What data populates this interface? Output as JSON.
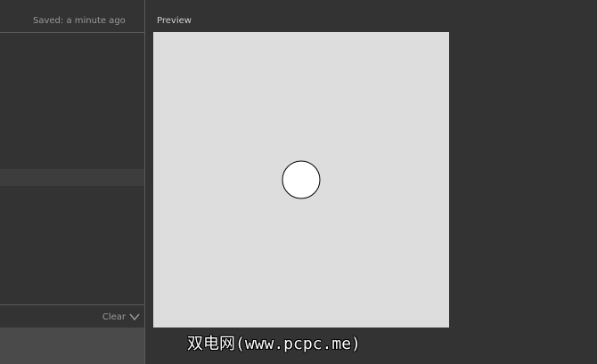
{
  "editor": {
    "saved_status": "Saved: a minute ago"
  },
  "console": {
    "clear_label": "Clear",
    "toggle_icon": "chevron-down-icon"
  },
  "preview": {
    "label": "Preview",
    "background": "#dddddd",
    "shape": {
      "type": "circle",
      "fill": "#ffffff",
      "stroke": "#000000"
    }
  },
  "watermark": {
    "text": "双电网(www.pcpc.me)"
  },
  "colors": {
    "app_background": "#333333",
    "panel_border": "#5a5a5a",
    "console_output_bg": "#4a4a4a"
  }
}
